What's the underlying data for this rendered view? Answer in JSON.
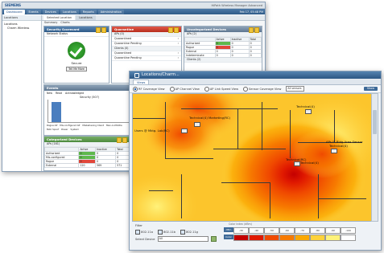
{
  "back": {
    "brand": "SIEMENS",
    "app_title": "HiPath Wireless Manager Advanced",
    "nav": [
      "Dashboard",
      "Events",
      "Devices",
      "Locations",
      "Reports",
      "Administration"
    ],
    "datetime": "Feb 17, 05:48 PM",
    "sidebar_header": "Locations",
    "tree": [
      "Locations",
      "Charm Wireless"
    ],
    "tabs": [
      "Selected Location",
      "Locations"
    ],
    "subtabs": [
      "Summary",
      "Charts"
    ],
    "security_panel": {
      "title": "Security Scorecard",
      "network_status": "Network Status",
      "status": "Secure",
      "button": "Tell Me More"
    },
    "quarantine_panel": {
      "title": "Quarantine",
      "aps_header": "APs (0)",
      "clients_header": "Clients (0)",
      "rows": [
        "Quarantined",
        "Quarantine Pending"
      ]
    },
    "uncat_panel": {
      "title": "Uncategorized Devices",
      "aps_header": "APs (2)",
      "cols": [
        "Active",
        "Inactive",
        "Total"
      ],
      "rows": [
        {
          "label": "Authorized",
          "v": [
            "0",
            "0",
            "0"
          ]
        },
        {
          "label": "Rogue",
          "v": [
            "0",
            "0",
            "0"
          ]
        },
        {
          "label": "External",
          "v": [
            "0",
            "0",
            "0"
          ]
        },
        {
          "label": "Indeterminate",
          "v": [
            "0",
            "0",
            "0"
          ]
        }
      ],
      "clients_header": "Clients (2)"
    },
    "events_panel": {
      "title": "Events",
      "filters": [
        "New",
        "Read",
        "Acknowledged"
      ],
      "chart_title": "Security (507)",
      "legend": [
        "Rogue AP",
        "Mis-configured AP",
        "Misbehaving Client",
        "Man-in-Middle",
        "MAC Spoof",
        "Power",
        "System"
      ]
    },
    "categorized_panel": {
      "title": "Categorized Devices",
      "aps_header": "APs (161)",
      "cols": [
        "Active",
        "Inactive",
        "Total"
      ],
      "rows": [
        {
          "label": "Authorized",
          "v": [
            "0",
            "0",
            "0"
          ]
        },
        {
          "label": "Mis-configured",
          "v": [
            "0",
            "0",
            "0"
          ]
        },
        {
          "label": "Rogue",
          "v": [
            "0",
            "0",
            "0"
          ]
        },
        {
          "label": "External",
          "v": [
            "120",
            "569",
            "571"
          ]
        }
      ]
    }
  },
  "front": {
    "title": "Locations/Charm...",
    "tab": "Views",
    "views": [
      {
        "label": "RF Coverage View",
        "on": true
      },
      {
        "label": "AP Channel View",
        "on": false
      },
      {
        "label": "AP Link Speed View",
        "on": false
      },
      {
        "label": "Sensor Coverage View",
        "on": false
      }
    ],
    "sensor_select": "All sensors",
    "action_button": "Show",
    "map_labels": [
      "Technical(4) Marketing(RC)",
      "Users @ Mktg. Lab(RC)",
      "Technical(4)",
      "APs-IS-Bldg.Area Sensor",
      "Technical(4)",
      "Technical(RC)",
      "Technical(4)"
    ],
    "filter_title": "Filter",
    "filters": [
      {
        "label": "802.11a",
        "on": true
      },
      {
        "label": "802.11b",
        "on": true
      },
      {
        "label": "802.11g",
        "on": true
      }
    ],
    "select_device_label": "Select Device",
    "select_device_value": "All",
    "legend_title": "Color index (dBm)",
    "legend_row_label_1": "dBm",
    "legend_row_label_2": "Color",
    "legend_values": [
      "-30",
      "-40",
      "-50",
      "-60",
      "-70",
      "-80",
      "-90",
      "-100"
    ],
    "colors": [
      "#c40000",
      "#e01900",
      "#f04a00",
      "#f77a00",
      "#fba800",
      "#ffd23a",
      "#fff27a",
      "#ffffff"
    ]
  }
}
